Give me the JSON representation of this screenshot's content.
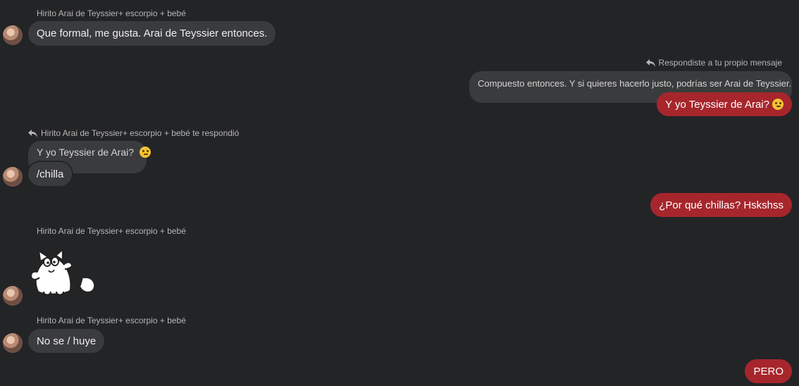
{
  "messages": {
    "m1": {
      "sender": "Hirito Arai de Teyssier+ escorpio + bebé",
      "text": "Que formal, me gusta. Arai de Teyssier entonces."
    },
    "m2": {
      "reply_note": "Respondiste a tu propio mensaje",
      "quoted": "Compuesto entonces. Y si quieres hacerlo justo, podrías ser Arai de Teyssier.",
      "text": "Y yo Teyssier de Arai?",
      "emoji": "thinking-face-icon"
    },
    "m3": {
      "reply_note": "Hirito Arai de Teyssier+ escorpio + bebé te respondió",
      "quoted": "Y yo Teyssier de Arai?",
      "quoted_emoji": "thinking-face-icon",
      "text": "/chilla"
    },
    "m4": {
      "text": "¿Por qué chillas? Hskshss"
    },
    "m5": {
      "sender": "Hirito Arai de Teyssier+ escorpio + bebé",
      "sticker": "cartoon-cat-sticker"
    },
    "m6": {
      "sender": "Hirito Arai de Teyssier+ escorpio + bebé",
      "text": "No se / huye"
    },
    "m7": {
      "text": "PERO"
    }
  },
  "colors": {
    "background": "#232426",
    "bubble_other": "#3a3b3d",
    "bubble_me": "#a6262c"
  }
}
